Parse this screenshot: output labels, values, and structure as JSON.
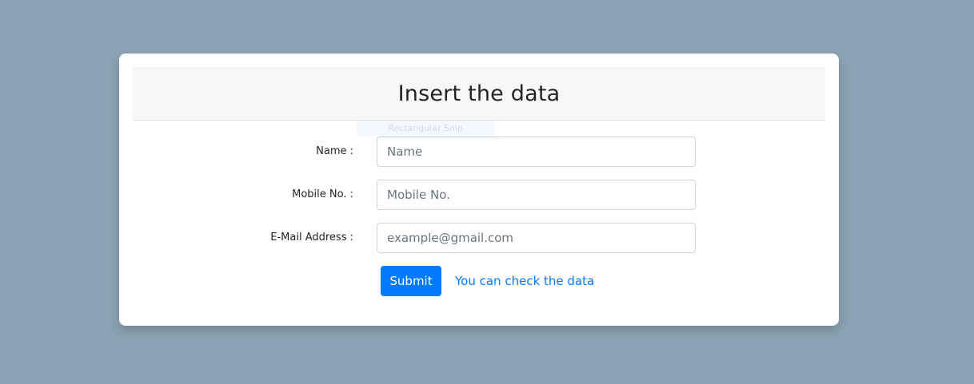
{
  "card": {
    "title": "Insert the data",
    "snip_ghost": "Rectangular Snip"
  },
  "form": {
    "fields": [
      {
        "label": "Name :",
        "placeholder": "Name",
        "value": ""
      },
      {
        "label": "Mobile No. :",
        "placeholder": "Mobile No.",
        "value": ""
      },
      {
        "label": "E-Mail Address :",
        "placeholder": "example@gmail.com",
        "value": ""
      }
    ],
    "submit_label": "Submit",
    "check_link_label": "You can check the data"
  },
  "colors": {
    "background": "#8ca3b3",
    "primary": "#007bff",
    "header_bg": "#f7f7f7"
  }
}
